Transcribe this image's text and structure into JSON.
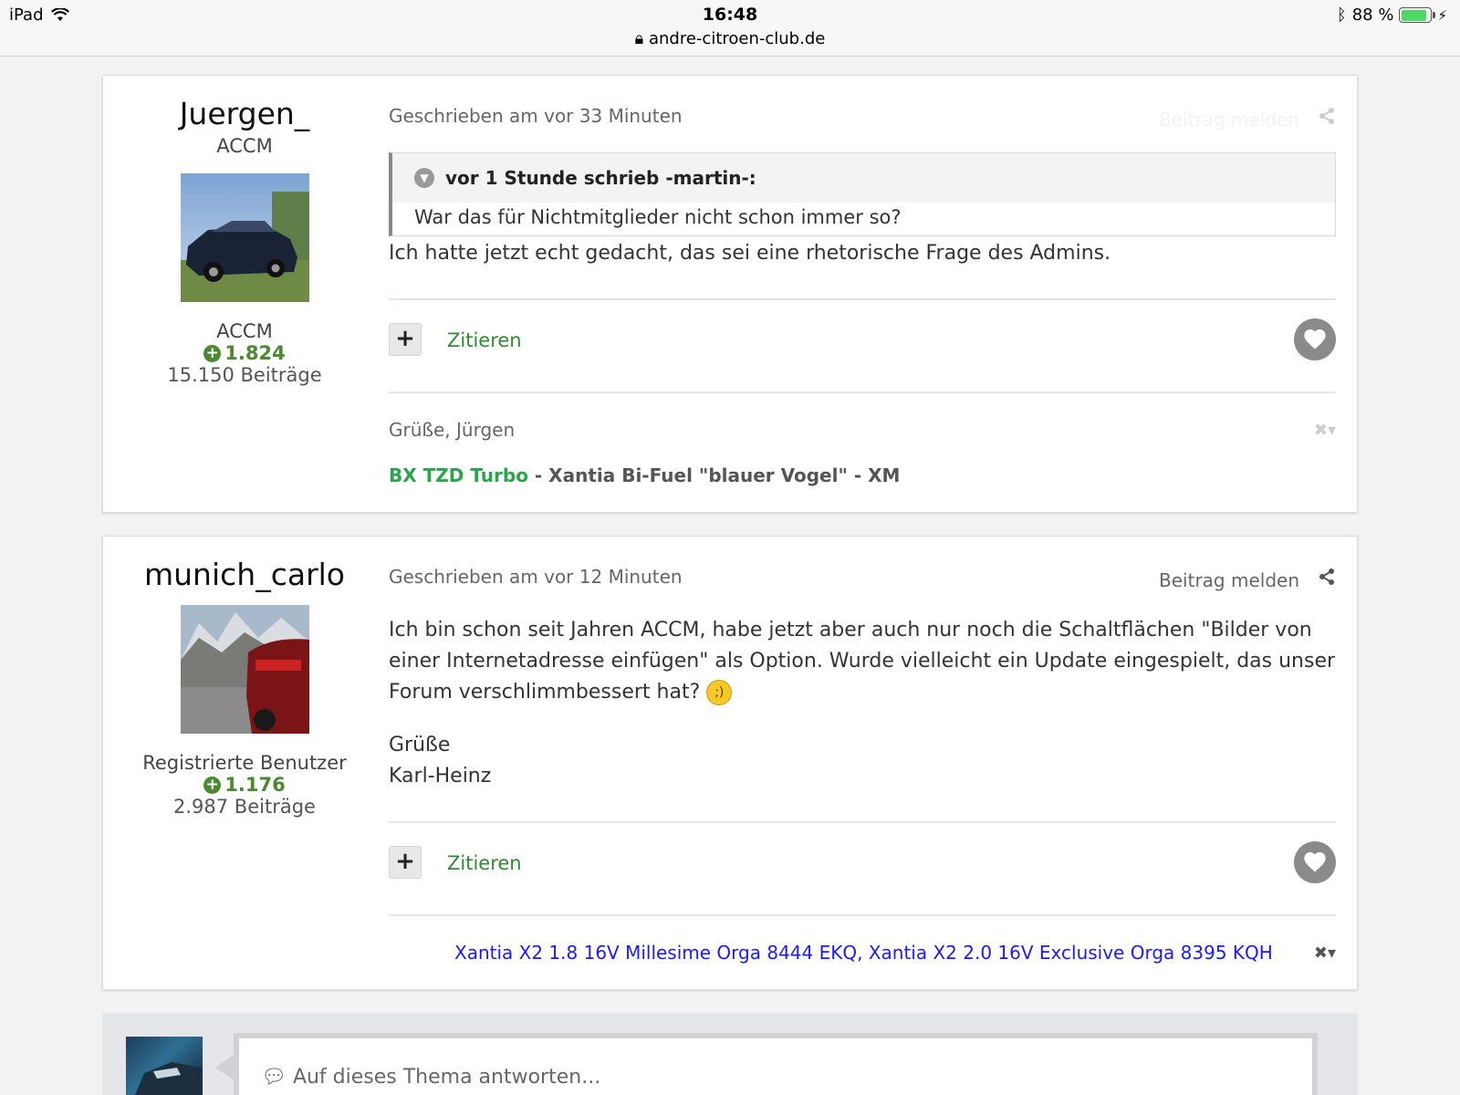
{
  "statusbar": {
    "device": "iPad",
    "time": "16:48",
    "url": "andre-citroen-club.de",
    "battery": "88 %",
    "battery_level": 0.88
  },
  "posts": [
    {
      "author": "Juergen_",
      "group_top": "ACCM",
      "group": "ACCM",
      "reputation": "1.824",
      "post_count": "15.150 Beiträge",
      "date": "Geschrieben am vor 33 Minuten",
      "report": "Beitrag melden",
      "quote": {
        "header": "vor 1 Stunde schrieb -martin-:",
        "text": "War das für Nichtmitglieder nicht schon immer so?"
      },
      "text": "Ich hatte jetzt echt gedacht, das sei eine rhetorische Frage des Admins.",
      "plus_label": "+",
      "cite_label": "Zitieren",
      "signature": {
        "greeting": "Grüße, Jürgen",
        "link": "BX TZD Turbo",
        "rest": " - Xantia Bi-Fuel \"blauer Vogel\" - XM"
      }
    },
    {
      "author": "munich_carlo",
      "group": "Registrierte Benutzer",
      "reputation": "1.176",
      "post_count": "2.987 Beiträge",
      "date": "Geschrieben am vor 12 Minuten",
      "report": "Beitrag melden",
      "text_paragraph": "Ich bin schon seit Jahren ACCM, habe jetzt aber auch nur noch die Schaltflächen \"Bilder von einer Internetadresse einfügen\" als Option. Wurde vielleicht ein Update eingespielt, das unser Forum verschlimmbessert hat?",
      "greeting": "Grüße",
      "name": "Karl-Heinz",
      "plus_label": "+",
      "cite_label": "Zitieren",
      "signature": {
        "link": "Xantia X2 1.8 16V Millesime Orga 8444 EKQ, Xantia X2 2.0 16V Exclusive Orga 8395 KQH"
      }
    }
  ],
  "reply": {
    "placeholder": "Auf dieses Thema antworten..."
  },
  "colors": {
    "accent_green": "#2f8b2f",
    "rep_green": "#4b8a2e",
    "signature_blue": "#1a1aff",
    "like_gray": "#8a8a8a"
  }
}
